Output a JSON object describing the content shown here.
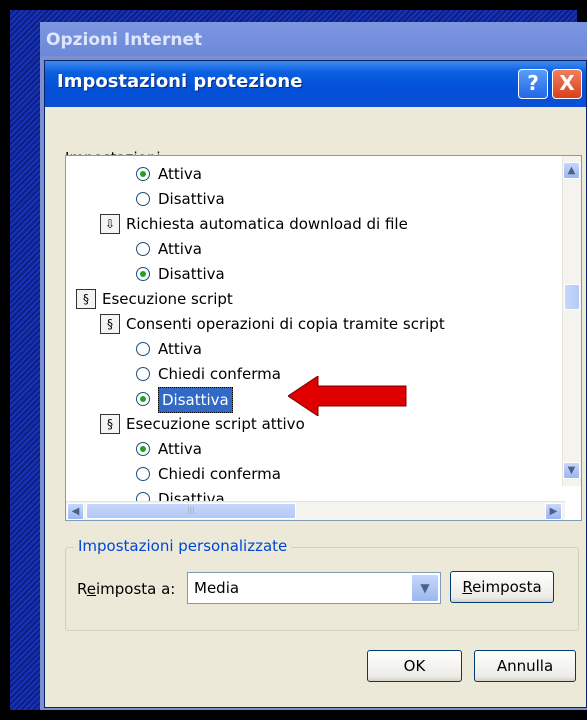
{
  "window": {
    "outer_title": "Opzioni Internet",
    "title": "Impostazioni protezione",
    "help_label": "?",
    "close_label": "X"
  },
  "settings_label_pre": "Impo",
  "settings_label_acc": "s",
  "settings_label_post": "tazioni:",
  "tree": [
    {
      "type": "option",
      "label": "Attiva",
      "checked": true
    },
    {
      "type": "option",
      "label": "Disattiva",
      "checked": false
    },
    {
      "type": "group",
      "label": "Richiesta automatica download di file",
      "icon": "download-icon"
    },
    {
      "type": "option",
      "label": "Attiva",
      "checked": false
    },
    {
      "type": "option",
      "label": "Disattiva",
      "checked": true
    },
    {
      "type": "category",
      "label": "Esecuzione script",
      "icon": "script-icon"
    },
    {
      "type": "group",
      "label": "Consenti operazioni di copia tramite script",
      "icon": "script-icon"
    },
    {
      "type": "option",
      "label": "Attiva",
      "checked": false
    },
    {
      "type": "option",
      "label": "Chiedi conferma",
      "checked": false
    },
    {
      "type": "option",
      "label": "Disattiva",
      "checked": true,
      "selected": true
    },
    {
      "type": "group",
      "label": "Esecuzione script attivo",
      "icon": "script-icon"
    },
    {
      "type": "option",
      "label": "Attiva",
      "checked": true
    },
    {
      "type": "option",
      "label": "Chiedi conferma",
      "checked": false
    },
    {
      "type": "option",
      "label": "Disattiva",
      "checked": false
    }
  ],
  "custom": {
    "group_title": "Impostazioni personalizzate",
    "reset_pre": "R",
    "reset_acc": "e",
    "reset_post": "imposta a:",
    "combo_value": "Media",
    "reset_btn_acc": "R",
    "reset_btn_post": "eimposta"
  },
  "buttons": {
    "ok": "OK",
    "cancel": "Annulla"
  },
  "colors": {
    "selection": "#316ac5",
    "arrow": "#e00000",
    "titlebar": "#0a5fe0"
  }
}
